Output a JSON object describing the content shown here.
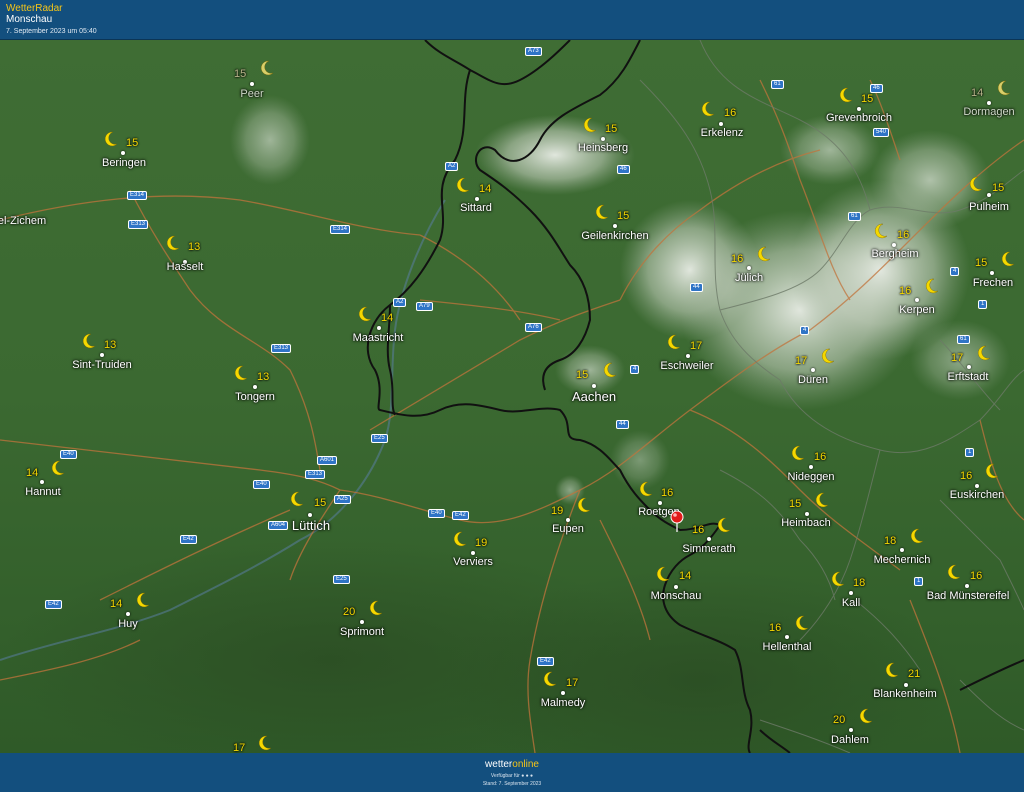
{
  "header": {
    "app_title": "WetterRadar",
    "location": "Monschau",
    "timestamp": "7. September 2023 um 05:40"
  },
  "footer": {
    "brand_prefix": "wetter",
    "brand_accent": "online",
    "available_on": "Verfügbar für",
    "stand": "Stand: 7. September 2023"
  },
  "colors": {
    "header_bg": "#134f7e",
    "temperature": "#f5d800",
    "moon": "#f5d800",
    "road_sign": "#2f74c6",
    "pin": "#e21b1b"
  },
  "cities": [
    {
      "id": "peer",
      "name": "Peer",
      "temp": "15",
      "icon": "moon-icon",
      "dim": true
    },
    {
      "id": "beringen",
      "name": "Beringen",
      "temp": "15",
      "icon": "moon-icon"
    },
    {
      "id": "hasselt",
      "name": "Hasselt",
      "temp": "13",
      "icon": "moon-icon"
    },
    {
      "id": "sint-truiden",
      "name": "Sint-Truiden",
      "temp": "13",
      "icon": "moon-icon"
    },
    {
      "id": "tongern",
      "name": "Tongern",
      "temp": "13",
      "icon": "moon-icon"
    },
    {
      "id": "hannut",
      "name": "Hannut",
      "temp": "14",
      "icon": "moon-icon"
    },
    {
      "id": "huy",
      "name": "Huy",
      "temp": "14",
      "icon": "moon-icon"
    },
    {
      "id": "luettich",
      "name": "Lüttich",
      "temp": "15",
      "icon": "moon-icon",
      "big": true
    },
    {
      "id": "sprimont",
      "name": "Sprimont",
      "temp": "20",
      "icon": "moon-icon"
    },
    {
      "id": "maastricht",
      "name": "Maastricht",
      "temp": "14",
      "icon": "moon-icon"
    },
    {
      "id": "sittard",
      "name": "Sittard",
      "temp": "14",
      "icon": "moon-icon"
    },
    {
      "id": "verviers",
      "name": "Verviers",
      "temp": "19",
      "icon": "moon-icon"
    },
    {
      "id": "eupen",
      "name": "Eupen",
      "temp": "19",
      "icon": "moon-icon"
    },
    {
      "id": "malmedy",
      "name": "Malmedy",
      "temp": "17",
      "icon": "moon-icon"
    },
    {
      "id": "aachen",
      "name": "Aachen",
      "temp": "15",
      "icon": "moon-icon",
      "big": true
    },
    {
      "id": "heinsberg",
      "name": "Heinsberg",
      "temp": "15",
      "icon": "moon-icon"
    },
    {
      "id": "geilenkirchen",
      "name": "Geilenkirchen",
      "temp": "15",
      "icon": "moon-icon"
    },
    {
      "id": "erkelenz",
      "name": "Erkelenz",
      "temp": "16",
      "icon": "moon-icon"
    },
    {
      "id": "juelich",
      "name": "Jülich",
      "temp": "16",
      "icon": "moon-icon"
    },
    {
      "id": "eschweiler",
      "name": "Eschweiler",
      "temp": "17",
      "icon": "moon-icon"
    },
    {
      "id": "roetgen",
      "name": "Roetgen",
      "temp": "16",
      "icon": "moon-icon"
    },
    {
      "id": "simmerath",
      "name": "Simmerath",
      "temp": "16",
      "icon": "moon-icon"
    },
    {
      "id": "monschau",
      "name": "Monschau",
      "temp": "14",
      "icon": "moon-icon"
    },
    {
      "id": "hellenthal",
      "name": "Hellenthal",
      "temp": "16",
      "icon": "moon-icon"
    },
    {
      "id": "heimbach",
      "name": "Heimbach",
      "temp": "15",
      "icon": "moon-icon"
    },
    {
      "id": "nideggen",
      "name": "Nideggen",
      "temp": "16",
      "icon": "moon-icon"
    },
    {
      "id": "dueren",
      "name": "Düren",
      "temp": "17",
      "icon": "moon-icon"
    },
    {
      "id": "kall",
      "name": "Kall",
      "temp": "18",
      "icon": "moon-icon"
    },
    {
      "id": "grevenbroich",
      "name": "Grevenbroich",
      "temp": "15",
      "icon": "moon-icon"
    },
    {
      "id": "bergheim",
      "name": "Bergheim",
      "temp": "16",
      "icon": "moon-icon"
    },
    {
      "id": "kerpen",
      "name": "Kerpen",
      "temp": "16",
      "icon": "moon-icon"
    },
    {
      "id": "erftstadt",
      "name": "Erftstadt",
      "temp": "17",
      "icon": "moon-icon"
    },
    {
      "id": "euskirchen",
      "name": "Euskirchen",
      "temp": "16",
      "icon": "moon-icon"
    },
    {
      "id": "mechernich",
      "name": "Mechernich",
      "temp": "18",
      "icon": "moon-icon"
    },
    {
      "id": "bad-muenstereifel",
      "name": "Bad Münstereifel",
      "temp": "16",
      "icon": "moon-icon"
    },
    {
      "id": "blankenheim",
      "name": "Blankenheim",
      "temp": "21",
      "icon": "moon-icon"
    },
    {
      "id": "dahlem",
      "name": "Dahlem",
      "temp": "20",
      "icon": "moon-icon"
    },
    {
      "id": "dormagen",
      "name": "Dormagen",
      "temp": "14",
      "icon": "moon-icon",
      "dim": true
    },
    {
      "id": "pulheim",
      "name": "Pulheim",
      "temp": "15",
      "icon": "moon-icon"
    },
    {
      "id": "frechen",
      "name": "Frechen",
      "temp": "15",
      "icon": "moon-icon"
    },
    {
      "id": "zichem",
      "name": "el-Zichem",
      "temp": "",
      "icon": ""
    },
    {
      "id": "south-edge",
      "name": "",
      "temp": "17",
      "icon": "moon-icon"
    }
  ],
  "road_signs": [
    "A73",
    "61",
    "46",
    "A2",
    "E314",
    "E313",
    "E314",
    "540",
    "46",
    "61",
    "A2",
    "A79",
    "44",
    "4",
    "4",
    "A76",
    "E313",
    "1",
    "61",
    "E25",
    "E40",
    "A601",
    "E313",
    "E40",
    "A25",
    "A604",
    "E40",
    "E42",
    "E42",
    "44",
    "1",
    "E25",
    "E42",
    "1",
    "E42",
    "4"
  ]
}
